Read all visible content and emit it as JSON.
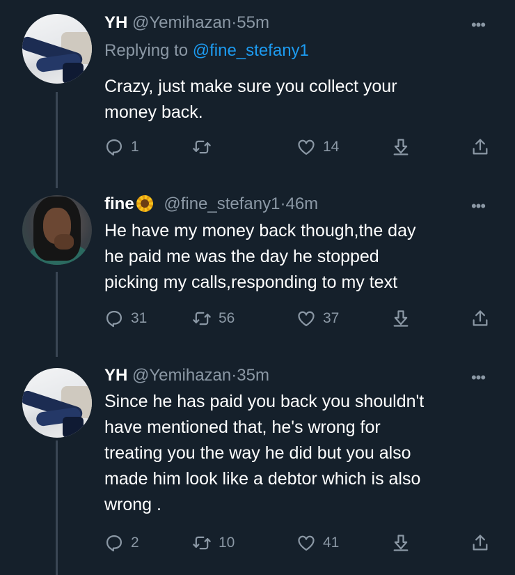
{
  "tweets": [
    {
      "name": "YH",
      "handle": "@Yemihazan",
      "separator": "·",
      "time": "55m",
      "reply_prefix": "Replying to",
      "reply_handle": "@fine_stefany1",
      "body_lines": [
        "Crazy, just make sure you collect your",
        "money back."
      ],
      "replies": "1",
      "retweets": "",
      "likes": "14"
    },
    {
      "name": "fine",
      "emoji": "sunflower-emoji",
      "handle": "@fine_stefany1",
      "separator": "·",
      "time": "46m",
      "body_lines": [
        "He have my money back though,the day",
        "he paid me was the day he stopped",
        "picking my calls,responding to my text"
      ],
      "replies": "31",
      "retweets": "56",
      "likes": "37"
    },
    {
      "name": "YH",
      "handle": "@Yemihazan",
      "separator": "·",
      "time": "35m",
      "body_lines": [
        "Since he has paid you back you shouldn't",
        "have mentioned that, he's wrong for",
        "treating you the way he did but you also",
        "made him look like a debtor which is also",
        "wrong ."
      ],
      "replies": "2",
      "retweets": "10",
      "likes": "41"
    }
  ],
  "icons": {
    "more": "more-horizontal-icon",
    "reply": "reply-icon",
    "retweet": "retweet-icon",
    "like": "heart-icon",
    "download": "download-icon",
    "share": "share-icon"
  },
  "colors": {
    "background": "#15202b",
    "text": "#ffffff",
    "muted": "#8b98a5",
    "link": "#1d9bf0",
    "thread_line": "#3a4654"
  }
}
